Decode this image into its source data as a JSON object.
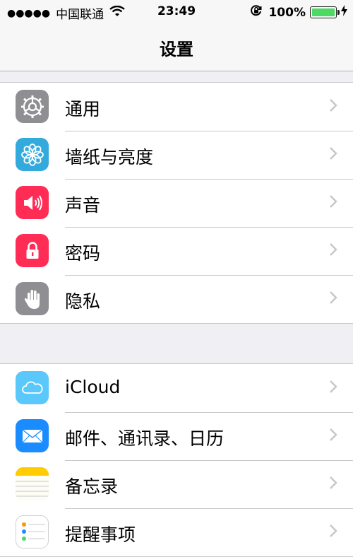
{
  "status_bar": {
    "signal": "●●●●●",
    "carrier": "中国联通",
    "time": "23:49",
    "battery": "100%",
    "battery_level": 1.0,
    "battery_color": "#4cd964"
  },
  "nav": {
    "title": "设置"
  },
  "groups": [
    {
      "items": [
        {
          "label": "通用",
          "icon": "gear-icon",
          "color": "#8e8e93"
        },
        {
          "label": "墙纸与亮度",
          "icon": "flower-icon",
          "color": "#34aadc"
        },
        {
          "label": "声音",
          "icon": "speaker-icon",
          "color": "#ff2d55"
        },
        {
          "label": "密码",
          "icon": "lock-icon",
          "color": "#ff2d55"
        },
        {
          "label": "隐私",
          "icon": "hand-icon",
          "color": "#8e8e93"
        }
      ]
    },
    {
      "items": [
        {
          "label": "iCloud",
          "icon": "cloud-icon",
          "color": "#5ac8fa"
        },
        {
          "label": "邮件、通讯录、日历",
          "icon": "mail-icon",
          "color": "#1a8cff"
        },
        {
          "label": "备忘录",
          "icon": "notes-icon",
          "color": "#ffcc00"
        },
        {
          "label": "提醒事项",
          "icon": "reminders-icon",
          "color": "#ffffff"
        }
      ]
    }
  ]
}
